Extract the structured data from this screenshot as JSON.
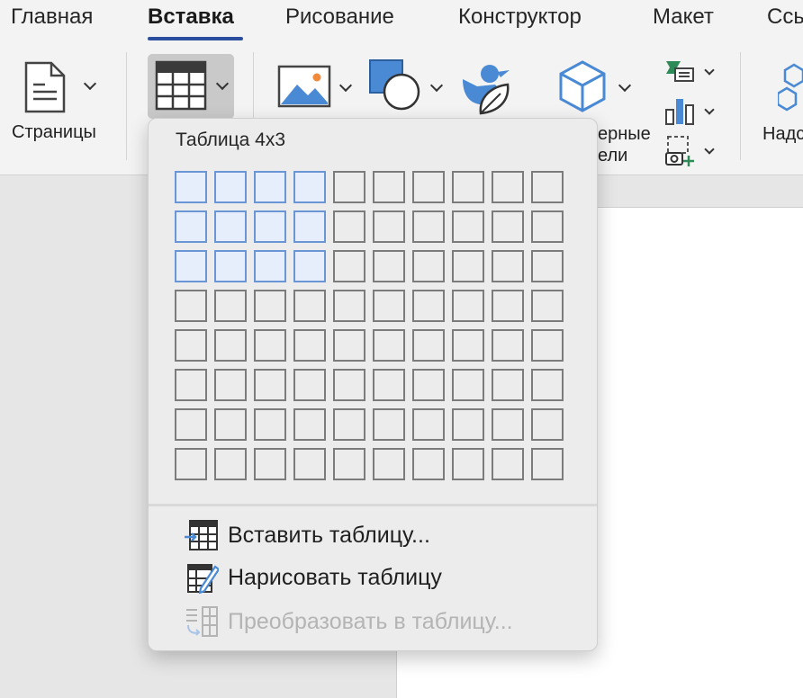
{
  "tabs": [
    {
      "label": "Главная",
      "active": false
    },
    {
      "label": "Вставка",
      "active": true
    },
    {
      "label": "Рисование",
      "active": false
    },
    {
      "label": "Конструктор",
      "active": false
    },
    {
      "label": "Макет",
      "active": false
    },
    {
      "label": "Ссы",
      "active": false
    }
  ],
  "ribbon": {
    "pages_label": "Страницы",
    "models_label_line1": "ерные",
    "models_label_line2": "ели",
    "addins_label": "Надс"
  },
  "table_dropdown": {
    "title": "Таблица 4x3",
    "grid": {
      "columns": 10,
      "rows": 8,
      "selected_columns": 4,
      "selected_rows": 3
    },
    "items": [
      {
        "label": "Вставить таблицу...",
        "icon": "insert-table-icon",
        "enabled": true
      },
      {
        "label": "Нарисовать таблицу",
        "icon": "draw-table-icon",
        "enabled": true
      },
      {
        "label": "Преобразовать в таблицу...",
        "icon": "convert-to-table-icon",
        "enabled": false
      }
    ]
  },
  "colors": {
    "accent": "#2b4f9e",
    "selection_border": "#6b96d6",
    "selection_fill": "#e5eefa",
    "icon_blue": "#4a8ad4"
  }
}
